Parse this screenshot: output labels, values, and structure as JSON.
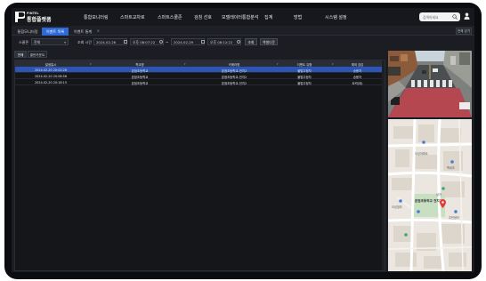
{
  "app": {
    "logo_sub": "PINTEL",
    "logo_main": "통합플랫폼"
  },
  "nav": {
    "items": [
      "통합모니터링",
      "스마트교차로",
      "스마트스쿨존",
      "검침 선호",
      "모델레이터통합분석",
      "집계",
      "방법",
      "시스템 설정"
    ],
    "search_placeholder": "검색하세요"
  },
  "tabs": [
    {
      "label": "통합모니터링",
      "active": false
    },
    {
      "label": "이벤트 목록",
      "active": true
    },
    {
      "label": "이벤트 통계",
      "active": false
    }
  ],
  "close_all_label": "전체 닫기",
  "filters": {
    "school_label": "스쿨존",
    "school_value": "전체",
    "period_label": "조회 시간",
    "start_date": "2024-02-26",
    "start_time": "오후 08:07:22",
    "separator": "~",
    "end_date": "2024-02-29",
    "end_time": "오후 08:12:22",
    "search_button": "조회",
    "excel_button": "엑셀다운"
  },
  "subtabs": [
    "전체",
    "쿨런카운트"
  ],
  "table": {
    "columns": [
      "발생일시",
      "학교명",
      "카메라명",
      "이벤트 유형",
      "예외 검감"
    ],
    "rows": [
      [
        "2024-02-20 20:02:26",
        "본점초등학교",
        "본점초등학교-전치2",
        "불법주정차",
        "승용차"
      ],
      [
        "2024-02-20 20:08:56",
        "본점초등학교",
        "본점초등학교-전치2",
        "불법주정차",
        "승용차"
      ],
      [
        "2024-02-20 20:18:15",
        "본점초등학교",
        "본점초등학교-전치2",
        "불법주정차",
        "트럭(대)"
      ]
    ],
    "selected_row": 0
  },
  "map": {
    "school_label": "본점초등학교 전치2",
    "labels": [
      "오성아파트",
      "백세초",
      "오성빌라",
      "상가",
      "주민센터"
    ]
  },
  "colors": {
    "accent": "#2f6bd8",
    "selected_row": "#2b56b8",
    "background": "#1b1d22",
    "marker": "#e53935"
  }
}
